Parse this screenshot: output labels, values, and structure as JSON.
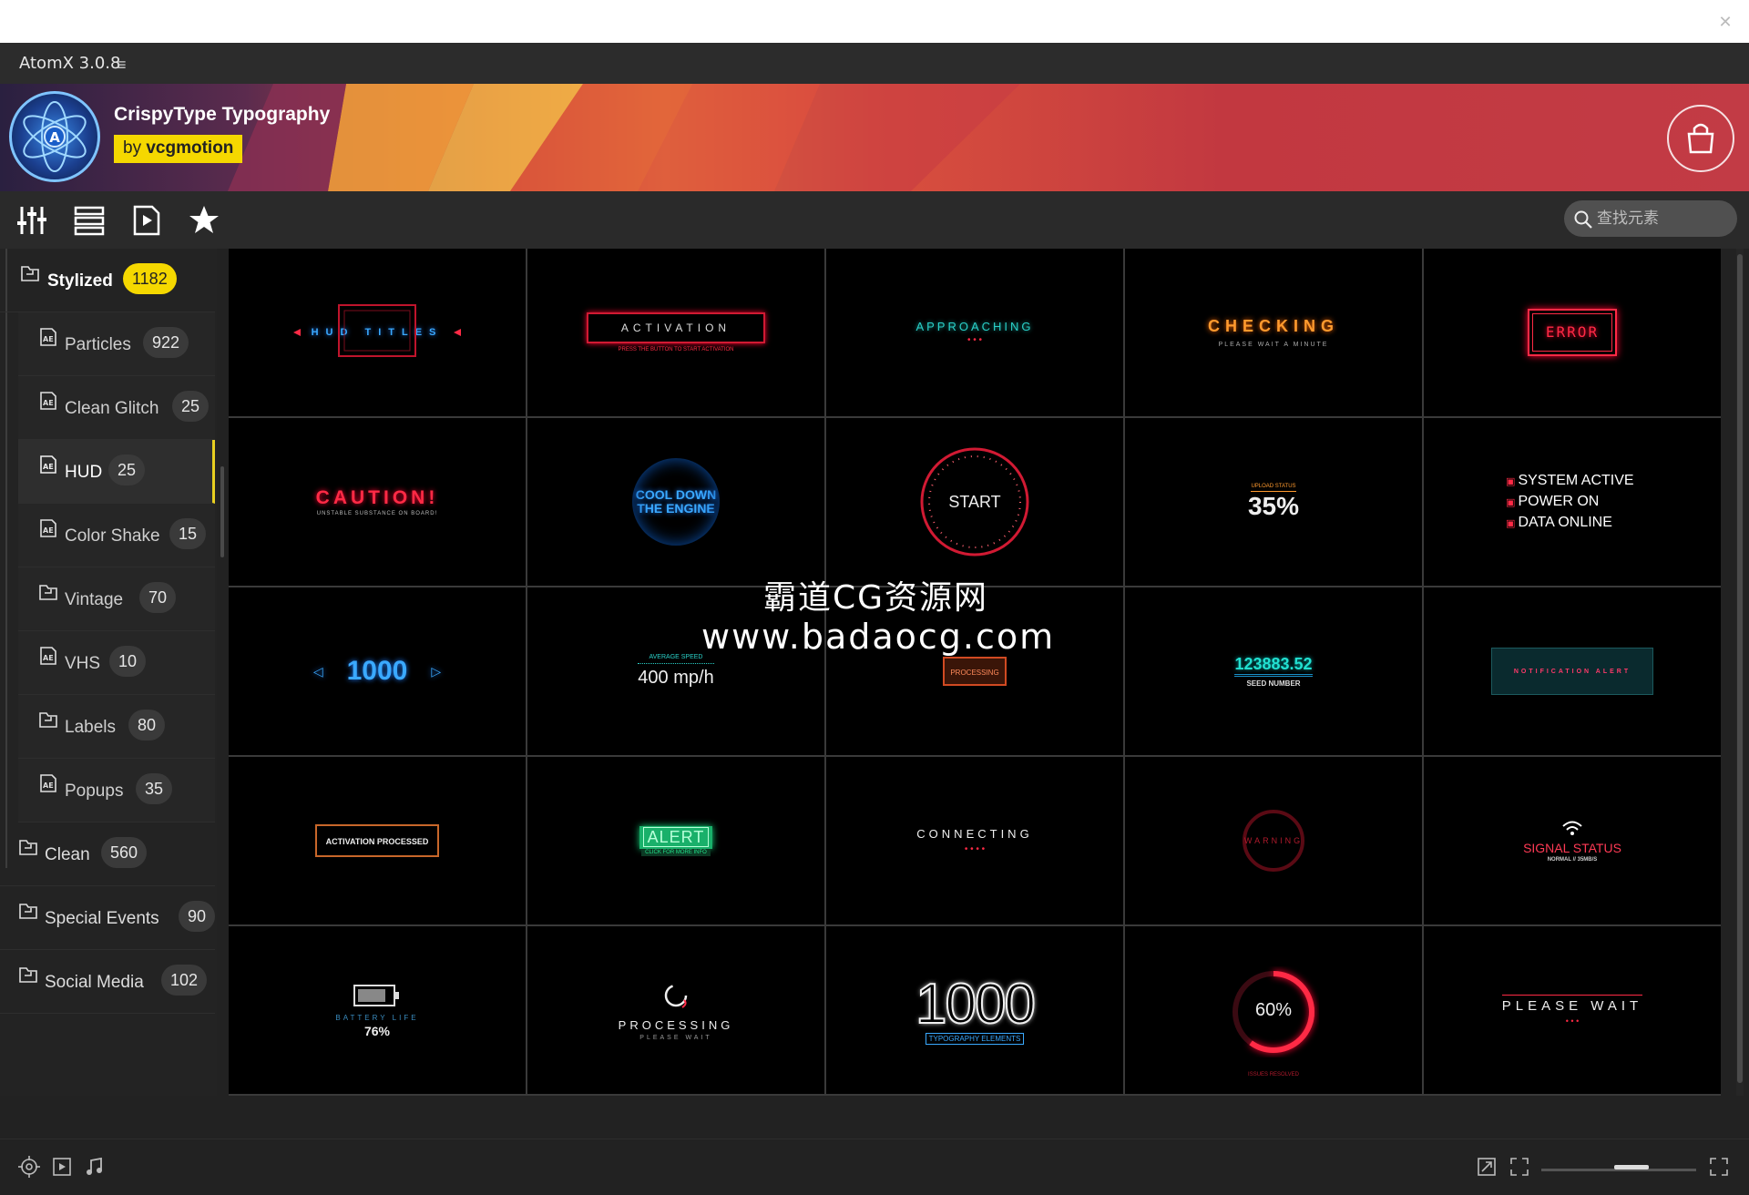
{
  "app": {
    "title": "AtomX 3.0.8"
  },
  "banner": {
    "pack_title": "CrispyType Typography",
    "author_prefix": "by",
    "author": "vcgmotion"
  },
  "search": {
    "placeholder": "查找元素"
  },
  "sidebar": {
    "items": [
      {
        "label": "Stylized",
        "count": "1182",
        "level": "category",
        "active": true
      },
      {
        "label": "Particles",
        "count": "922",
        "level": "sub"
      },
      {
        "label": "Clean Glitch",
        "count": "25",
        "level": "sub"
      },
      {
        "label": "HUD",
        "count": "25",
        "level": "sub",
        "selected": true
      },
      {
        "label": "Color Shake",
        "count": "15",
        "level": "sub"
      },
      {
        "label": "Vintage",
        "count": "70",
        "level": "sub"
      },
      {
        "label": "VHS",
        "count": "10",
        "level": "sub"
      },
      {
        "label": "Labels",
        "count": "80",
        "level": "sub"
      },
      {
        "label": "Popups",
        "count": "35",
        "level": "sub"
      },
      {
        "label": "Clean",
        "count": "560",
        "level": "category"
      },
      {
        "label": "Special Events",
        "count": "90",
        "level": "category"
      },
      {
        "label": "Social Media",
        "count": "102",
        "level": "category"
      }
    ]
  },
  "grid": {
    "cells": [
      {
        "main": "HUD TITLES",
        "sub": ""
      },
      {
        "main": "ACTIVATION",
        "sub": "PRESS THE BUTTON TO START ACTIVATION"
      },
      {
        "main": "APPROACHING",
        "sub": "• • •"
      },
      {
        "main": "CHECKING",
        "sub": "PLEASE WAIT A MINUTE"
      },
      {
        "main": "ERROR",
        "sub": ""
      },
      {
        "main": "CAUTION!",
        "sub": "UNSTABLE SUBSTANCE ON BOARD!"
      },
      {
        "main": "COOL DOWN",
        "sub": "THE ENGINE"
      },
      {
        "main": "START",
        "sub": ""
      },
      {
        "main": "35%",
        "sub": "UPLOAD STATUS"
      },
      {
        "main": "SYSTEM ACTIVE",
        "sub": "POWER ON",
        "sub2": "DATA ONLINE"
      },
      {
        "main": "1000",
        "sub": ""
      },
      {
        "main": "400 mp/h",
        "sub": "AVERAGE SPEED"
      },
      {
        "main": "PROCESSING",
        "sub": ""
      },
      {
        "main": "123883.52",
        "sub": "SEED NUMBER"
      },
      {
        "main": "NOTIFICATION ALERT",
        "sub": ""
      },
      {
        "main": "ACTIVATION PROCESSED",
        "sub": ""
      },
      {
        "main": "ALERT",
        "sub": "CLICK FOR MORE INFO"
      },
      {
        "main": "CONNECTING",
        "sub": "• • • •"
      },
      {
        "main": "WARNING",
        "sub": ""
      },
      {
        "main": "SIGNAL STATUS",
        "sub": "NORMAL // 35MB/S"
      },
      {
        "main": "76%",
        "sub": "BATTERY LIFE"
      },
      {
        "main": "PROCESSING",
        "sub": "PLEASE WAIT"
      },
      {
        "main": "1000",
        "sub": "TYPOGRAPHY ELEMENTS"
      },
      {
        "main": "60%",
        "sub": "ISSUES RESOLVED"
      },
      {
        "main": "PLEASE WAIT",
        "sub": "• • •"
      }
    ]
  },
  "watermark": {
    "line1": "霸道CG资源网",
    "line2": "www.badaocg.com"
  },
  "colors": {
    "accent": "#f5d800",
    "hud_red": "#ff2a45",
    "hud_blue": "#3aa9ff",
    "hud_green": "#22e08a"
  },
  "icons": [
    "equalizer-icon",
    "list-icon",
    "video-file-icon",
    "star-icon",
    "search-icon",
    "shopping-bag-icon",
    "folder-icon",
    "ae-file-icon",
    "target-icon",
    "play-icon",
    "music-note-icon",
    "expand-icon",
    "fullscreen-icon",
    "maximize-icon"
  ]
}
